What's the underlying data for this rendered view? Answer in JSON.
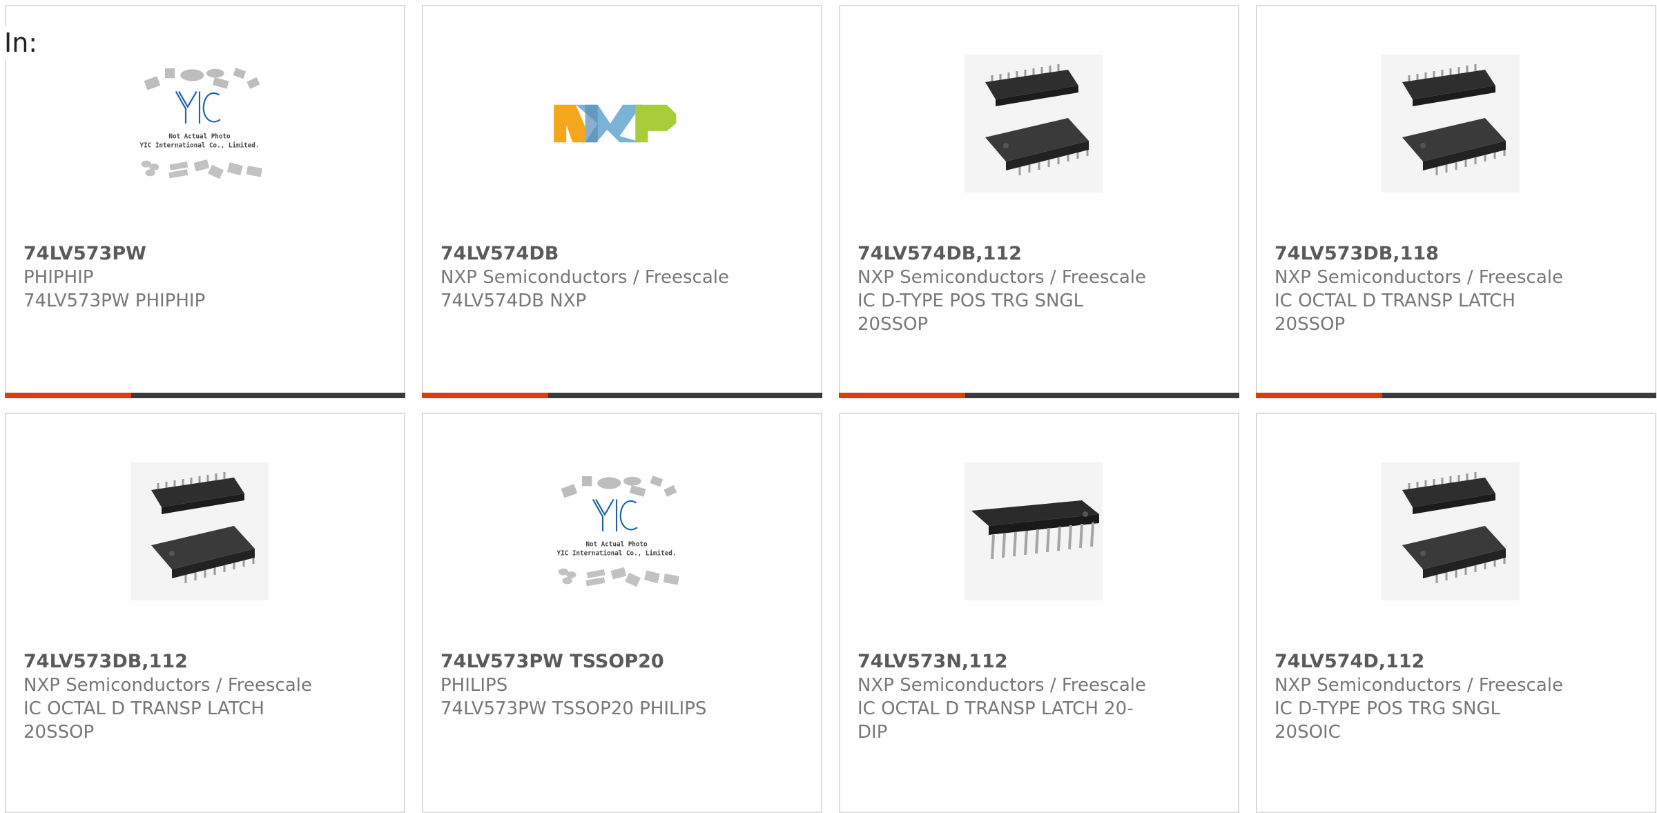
{
  "filter": {
    "label": "In:"
  },
  "products": [
    {
      "part_number": "74LV573PW",
      "manufacturer": "PHIPHIP",
      "description": "74LV573PW PHIPHIP",
      "image": "yic-placeholder"
    },
    {
      "part_number": "74LV574DB",
      "manufacturer": "NXP Semiconductors / Freescale",
      "description": "74LV574DB NXP",
      "image": "nxp-logo"
    },
    {
      "part_number": "74LV574DB,112",
      "manufacturer": "NXP Semiconductors / Freescale",
      "description": "IC D-TYPE POS TRG SNGL 20SSOP",
      "image": "ssop-chip"
    },
    {
      "part_number": "74LV573DB,118",
      "manufacturer": "NXP Semiconductors / Freescale",
      "description": "IC OCTAL D TRANSP LATCH 20SSOP",
      "image": "ssop-chip"
    },
    {
      "part_number": "74LV573DB,112",
      "manufacturer": "NXP Semiconductors / Freescale",
      "description": "IC OCTAL D TRANSP LATCH 20SSOP",
      "image": "ssop-chip"
    },
    {
      "part_number": "74LV573PW TSSOP20",
      "manufacturer": "PHILIPS",
      "description": "74LV573PW TSSOP20 PHILIPS",
      "image": "yic-placeholder"
    },
    {
      "part_number": "74LV573N,112",
      "manufacturer": "NXP Semiconductors / Freescale",
      "description": "IC OCTAL D TRANSP LATCH 20-DIP",
      "image": "dip-chip"
    },
    {
      "part_number": "74LV574D,112",
      "manufacturer": "NXP Semiconductors / Freescale",
      "description": "IC D-TYPE POS TRG SNGL 20SOIC",
      "image": "ssop-chip"
    }
  ],
  "placeholder": {
    "brand": "YIC",
    "line1": "Not Actual Photo",
    "line2": "YIC International Co., Limited."
  },
  "nxp_logo": {
    "text": "NXP"
  },
  "colors": {
    "accent": "#e03a12",
    "bar": "#3a3a3a",
    "border": "#dcdcdc"
  }
}
